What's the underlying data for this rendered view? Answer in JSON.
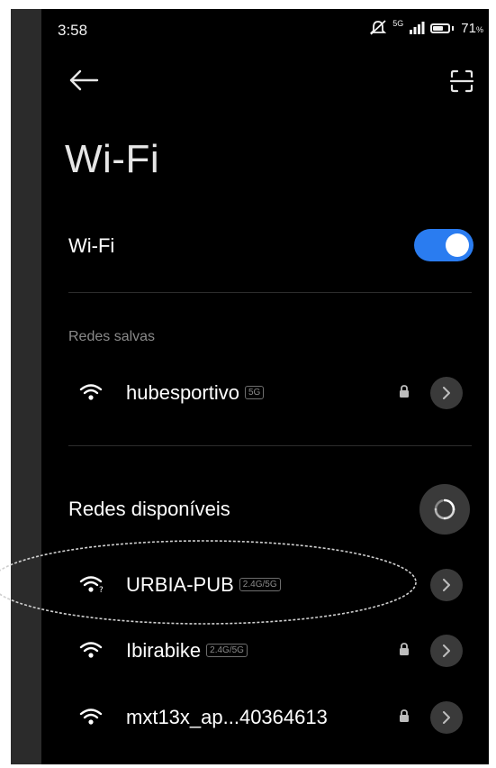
{
  "status_bar": {
    "time": "3:58",
    "network_type": "5G",
    "battery_percent": "71",
    "battery_unit": "%",
    "battery_level": 0.71,
    "icons": [
      "mute-icon",
      "cellular-signal-icon",
      "battery-icon"
    ]
  },
  "app_bar": {
    "back_icon": "arrow-left-icon",
    "scan_icon": "qr-scan-icon"
  },
  "page": {
    "title": "Wi-Fi"
  },
  "wifi_toggle": {
    "label": "Wi-Fi",
    "enabled": true,
    "color": "#2a7cf0"
  },
  "saved_networks": {
    "label": "Redes salvas",
    "items": [
      {
        "ssid": "hubesportivo",
        "band": "5G",
        "secured": true
      }
    ]
  },
  "available_networks": {
    "label": "Redes disponíveis",
    "refresh_icon": "refresh-icon",
    "items": [
      {
        "ssid": "URBIA-PUB",
        "band": "2.4G/5G",
        "secured": false
      },
      {
        "ssid": "Ibirabike",
        "band": "2.4G/5G",
        "secured": true
      },
      {
        "ssid": "mxt13x_ap...40364613",
        "band": "",
        "secured": true
      }
    ]
  }
}
